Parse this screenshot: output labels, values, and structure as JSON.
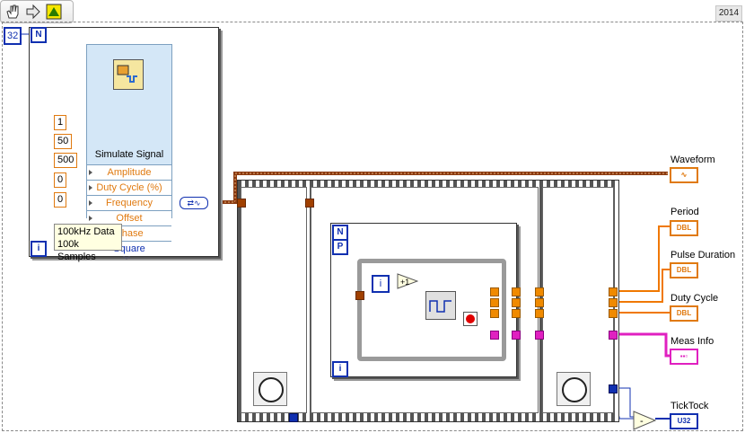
{
  "toolbar": {
    "run_icon": "hand-icon",
    "step_icon": "arrow-icon",
    "vi_icon": "labview-icon"
  },
  "version": "2014",
  "loop_count_const": "32",
  "loop_count_terminal": "N",
  "iteration_terminal": "i",
  "express_vi": {
    "title": "Simulate Signal",
    "rows": [
      "Amplitude",
      "Duty Cycle (%)",
      "Frequency",
      "Offset",
      "Phase",
      "Square"
    ]
  },
  "inputs": [
    "1",
    "50",
    "500",
    "0",
    "0"
  ],
  "comment": [
    "100kHz Data",
    "100k Samples"
  ],
  "inner_loop": {
    "count": "N",
    "parallel": "P",
    "iteration": "i",
    "increment": "+1"
  },
  "outputs": [
    {
      "label": "Waveform",
      "type": "waveform"
    },
    {
      "label": "Period",
      "type": "DBL"
    },
    {
      "label": "Pulse Duration",
      "type": "DBL"
    },
    {
      "label": "Duty Cycle",
      "type": "DBL"
    },
    {
      "label": "Meas Info",
      "type": "cluster"
    },
    {
      "label": "TickTock",
      "type": "U32"
    }
  ],
  "colors": {
    "wire_orange": "#f07800",
    "wire_brown": "#8a3a10",
    "wire_pink": "#e020c0",
    "wire_blue": "#1030b0"
  }
}
